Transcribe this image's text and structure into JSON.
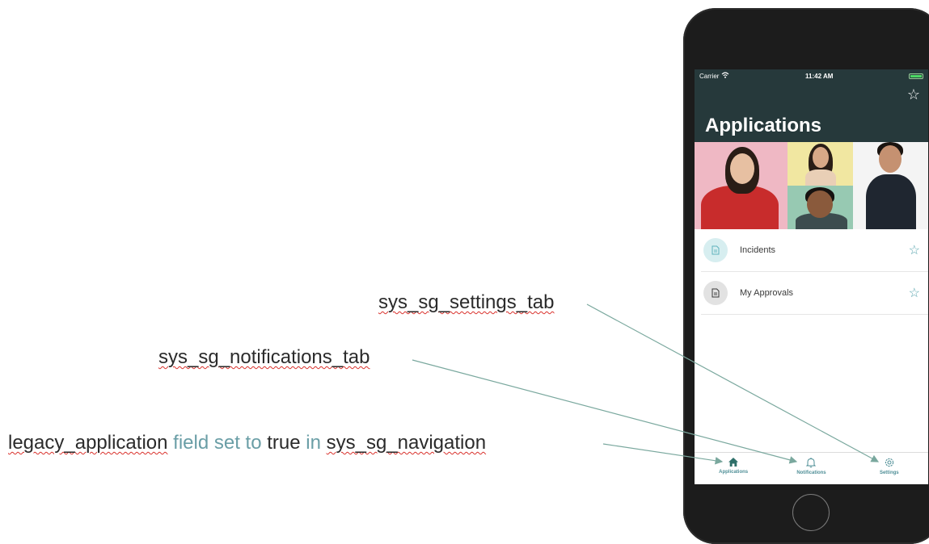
{
  "annotations": {
    "settings_tab": "sys_sg_settings_tab",
    "notifications_tab": "sys_sg_notifications_tab",
    "legacy": {
      "part1": "legacy_application",
      "part2": " field set to ",
      "part3": "true",
      "part4": " in ",
      "part5": "sys_sg_navigation"
    }
  },
  "status_bar": {
    "carrier": "Carrier",
    "time": "11:42 AM",
    "battery_level": 1.0
  },
  "header": {
    "title": "Applications",
    "favorite_icon": "star-outline-icon"
  },
  "list": {
    "items": [
      {
        "label": "Incidents",
        "icon": "document-icon"
      },
      {
        "label": "My Approvals",
        "icon": "document-icon"
      }
    ]
  },
  "tab_bar": {
    "tabs": [
      {
        "label": "Applications",
        "icon": "home-icon"
      },
      {
        "label": "Notifications",
        "icon": "bell-icon"
      },
      {
        "label": "Settings",
        "icon": "gear-icon"
      }
    ]
  },
  "colors": {
    "header_bg": "#26393b",
    "accent": "#4f8f97",
    "annotation_accent": "#6a9ea6",
    "arrow": "#7aa89e"
  }
}
